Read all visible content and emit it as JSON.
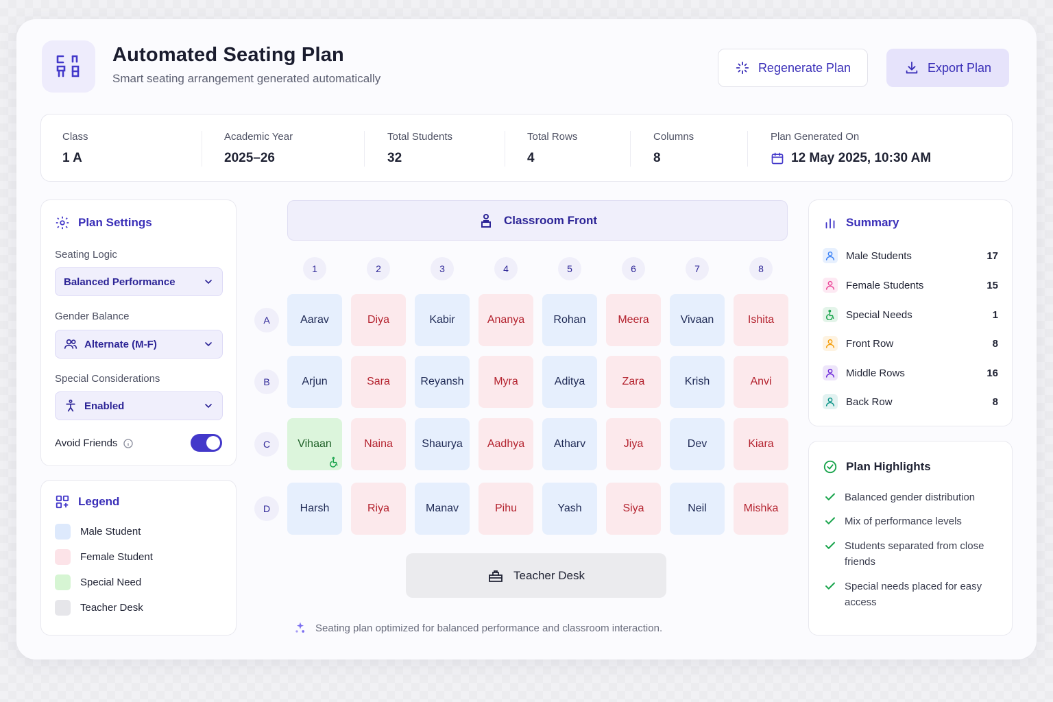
{
  "header": {
    "title": "Automated Seating Plan",
    "subtitle": "Smart seating arrangement generated automatically",
    "regenerate_label": "Regenerate Plan",
    "export_label": "Export Plan"
  },
  "info": {
    "class_label": "Class",
    "class_value": "1 A",
    "year_label": "Academic Year",
    "year_value": "2025–26",
    "students_label": "Total Students",
    "students_value": "32",
    "rows_label": "Total Rows",
    "rows_value": "4",
    "columns_label": "Columns",
    "columns_value": "8",
    "generated_label": "Plan Generated On",
    "generated_value": "12 May 2025, 10:30 AM"
  },
  "settings": {
    "title": "Plan Settings",
    "seating_logic_label": "Seating Logic",
    "seating_logic_value": "Balanced Performance",
    "gender_balance_label": "Gender Balance",
    "gender_balance_value": "Alternate (M-F)",
    "special_label": "Special Considerations",
    "special_value": "Enabled",
    "avoid_friends_label": "Avoid Friends",
    "avoid_friends_on": true
  },
  "legend": {
    "title": "Legend",
    "items": [
      {
        "label": "Male Student",
        "color": "#dde9fc"
      },
      {
        "label": "Female Student",
        "color": "#fce3e8"
      },
      {
        "label": "Special Need",
        "color": "#d6f5d3"
      },
      {
        "label": "Teacher Desk",
        "color": "#e6e6ea"
      }
    ]
  },
  "classroom": {
    "front_label": "Classroom Front",
    "columns": [
      "1",
      "2",
      "3",
      "4",
      "5",
      "6",
      "7",
      "8"
    ],
    "rows": [
      "A",
      "B",
      "C",
      "D"
    ],
    "seats": [
      [
        {
          "n": "Aarav",
          "g": "m"
        },
        {
          "n": "Diya",
          "g": "f"
        },
        {
          "n": "Kabir",
          "g": "m"
        },
        {
          "n": "Ananya",
          "g": "f"
        },
        {
          "n": "Rohan",
          "g": "m"
        },
        {
          "n": "Meera",
          "g": "f"
        },
        {
          "n": "Vivaan",
          "g": "m"
        },
        {
          "n": "Ishita",
          "g": "f"
        }
      ],
      [
        {
          "n": "Arjun",
          "g": "m"
        },
        {
          "n": "Sara",
          "g": "f"
        },
        {
          "n": "Reyansh",
          "g": "m"
        },
        {
          "n": "Myra",
          "g": "f"
        },
        {
          "n": "Aditya",
          "g": "m"
        },
        {
          "n": "Zara",
          "g": "f"
        },
        {
          "n": "Krish",
          "g": "m"
        },
        {
          "n": "Anvi",
          "g": "f"
        }
      ],
      [
        {
          "n": "Vihaan",
          "g": "s"
        },
        {
          "n": "Naina",
          "g": "f"
        },
        {
          "n": "Shaurya",
          "g": "m"
        },
        {
          "n": "Aadhya",
          "g": "f"
        },
        {
          "n": "Atharv",
          "g": "m"
        },
        {
          "n": "Jiya",
          "g": "f"
        },
        {
          "n": "Dev",
          "g": "m"
        },
        {
          "n": "Kiara",
          "g": "f"
        }
      ],
      [
        {
          "n": "Harsh",
          "g": "m"
        },
        {
          "n": "Riya",
          "g": "f"
        },
        {
          "n": "Manav",
          "g": "m"
        },
        {
          "n": "Pihu",
          "g": "f"
        },
        {
          "n": "Yash",
          "g": "m"
        },
        {
          "n": "Siya",
          "g": "f"
        },
        {
          "n": "Neil",
          "g": "m"
        },
        {
          "n": "Mishka",
          "g": "f"
        }
      ]
    ],
    "teacher_desk_label": "Teacher Desk",
    "footnote": "Seating plan optimized for balanced performance and classroom interaction."
  },
  "summary": {
    "title": "Summary",
    "items": [
      {
        "label": "Male Students",
        "value": "17",
        "icon": "user-icon",
        "color": "#3b82f6"
      },
      {
        "label": "Female Students",
        "value": "15",
        "icon": "user-icon",
        "color": "#ec4899"
      },
      {
        "label": "Special Needs",
        "value": "1",
        "icon": "accessibility-icon",
        "color": "#16a34a"
      },
      {
        "label": "Front Row",
        "value": "8",
        "icon": "user-icon",
        "color": "#f59e0b"
      },
      {
        "label": "Middle Rows",
        "value": "16",
        "icon": "user-icon",
        "color": "#6d28d9"
      },
      {
        "label": "Back Row",
        "value": "8",
        "icon": "user-icon",
        "color": "#0d9488"
      }
    ]
  },
  "highlights": {
    "title": "Plan Highlights",
    "items": [
      "Balanced gender distribution",
      "Mix of performance levels",
      "Students separated from close friends",
      "Special needs placed for easy access"
    ]
  },
  "colors": {
    "accent": "#4338ca",
    "male": "#e6effd",
    "female": "#fce9ec",
    "special": "#dcf5dc"
  }
}
